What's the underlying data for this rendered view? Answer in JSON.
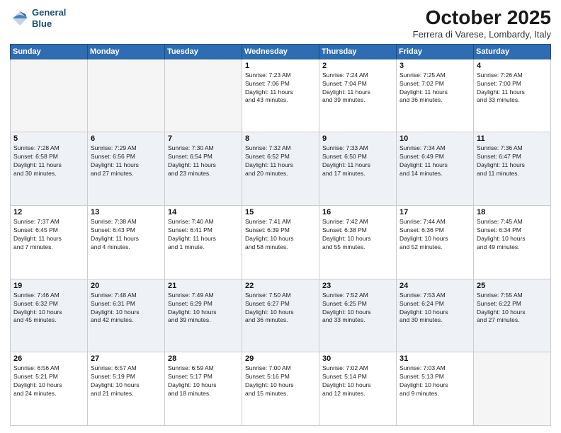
{
  "header": {
    "logo_line1": "General",
    "logo_line2": "Blue",
    "month": "October 2025",
    "location": "Ferrera di Varese, Lombardy, Italy"
  },
  "days_of_week": [
    "Sunday",
    "Monday",
    "Tuesday",
    "Wednesday",
    "Thursday",
    "Friday",
    "Saturday"
  ],
  "weeks": [
    [
      {
        "day": "",
        "info": ""
      },
      {
        "day": "",
        "info": ""
      },
      {
        "day": "",
        "info": ""
      },
      {
        "day": "1",
        "info": "Sunrise: 7:23 AM\nSunset: 7:06 PM\nDaylight: 11 hours\nand 43 minutes."
      },
      {
        "day": "2",
        "info": "Sunrise: 7:24 AM\nSunset: 7:04 PM\nDaylight: 11 hours\nand 39 minutes."
      },
      {
        "day": "3",
        "info": "Sunrise: 7:25 AM\nSunset: 7:02 PM\nDaylight: 11 hours\nand 36 minutes."
      },
      {
        "day": "4",
        "info": "Sunrise: 7:26 AM\nSunset: 7:00 PM\nDaylight: 11 hours\nand 33 minutes."
      }
    ],
    [
      {
        "day": "5",
        "info": "Sunrise: 7:28 AM\nSunset: 6:58 PM\nDaylight: 11 hours\nand 30 minutes."
      },
      {
        "day": "6",
        "info": "Sunrise: 7:29 AM\nSunset: 6:56 PM\nDaylight: 11 hours\nand 27 minutes."
      },
      {
        "day": "7",
        "info": "Sunrise: 7:30 AM\nSunset: 6:54 PM\nDaylight: 11 hours\nand 23 minutes."
      },
      {
        "day": "8",
        "info": "Sunrise: 7:32 AM\nSunset: 6:52 PM\nDaylight: 11 hours\nand 20 minutes."
      },
      {
        "day": "9",
        "info": "Sunrise: 7:33 AM\nSunset: 6:50 PM\nDaylight: 11 hours\nand 17 minutes."
      },
      {
        "day": "10",
        "info": "Sunrise: 7:34 AM\nSunset: 6:49 PM\nDaylight: 11 hours\nand 14 minutes."
      },
      {
        "day": "11",
        "info": "Sunrise: 7:36 AM\nSunset: 6:47 PM\nDaylight: 11 hours\nand 11 minutes."
      }
    ],
    [
      {
        "day": "12",
        "info": "Sunrise: 7:37 AM\nSunset: 6:45 PM\nDaylight: 11 hours\nand 7 minutes."
      },
      {
        "day": "13",
        "info": "Sunrise: 7:38 AM\nSunset: 6:43 PM\nDaylight: 11 hours\nand 4 minutes."
      },
      {
        "day": "14",
        "info": "Sunrise: 7:40 AM\nSunset: 6:41 PM\nDaylight: 11 hours\nand 1 minute."
      },
      {
        "day": "15",
        "info": "Sunrise: 7:41 AM\nSunset: 6:39 PM\nDaylight: 10 hours\nand 58 minutes."
      },
      {
        "day": "16",
        "info": "Sunrise: 7:42 AM\nSunset: 6:38 PM\nDaylight: 10 hours\nand 55 minutes."
      },
      {
        "day": "17",
        "info": "Sunrise: 7:44 AM\nSunset: 6:36 PM\nDaylight: 10 hours\nand 52 minutes."
      },
      {
        "day": "18",
        "info": "Sunrise: 7:45 AM\nSunset: 6:34 PM\nDaylight: 10 hours\nand 49 minutes."
      }
    ],
    [
      {
        "day": "19",
        "info": "Sunrise: 7:46 AM\nSunset: 6:32 PM\nDaylight: 10 hours\nand 45 minutes."
      },
      {
        "day": "20",
        "info": "Sunrise: 7:48 AM\nSunset: 6:31 PM\nDaylight: 10 hours\nand 42 minutes."
      },
      {
        "day": "21",
        "info": "Sunrise: 7:49 AM\nSunset: 6:29 PM\nDaylight: 10 hours\nand 39 minutes."
      },
      {
        "day": "22",
        "info": "Sunrise: 7:50 AM\nSunset: 6:27 PM\nDaylight: 10 hours\nand 36 minutes."
      },
      {
        "day": "23",
        "info": "Sunrise: 7:52 AM\nSunset: 6:25 PM\nDaylight: 10 hours\nand 33 minutes."
      },
      {
        "day": "24",
        "info": "Sunrise: 7:53 AM\nSunset: 6:24 PM\nDaylight: 10 hours\nand 30 minutes."
      },
      {
        "day": "25",
        "info": "Sunrise: 7:55 AM\nSunset: 6:22 PM\nDaylight: 10 hours\nand 27 minutes."
      }
    ],
    [
      {
        "day": "26",
        "info": "Sunrise: 6:56 AM\nSunset: 5:21 PM\nDaylight: 10 hours\nand 24 minutes."
      },
      {
        "day": "27",
        "info": "Sunrise: 6:57 AM\nSunset: 5:19 PM\nDaylight: 10 hours\nand 21 minutes."
      },
      {
        "day": "28",
        "info": "Sunrise: 6:59 AM\nSunset: 5:17 PM\nDaylight: 10 hours\nand 18 minutes."
      },
      {
        "day": "29",
        "info": "Sunrise: 7:00 AM\nSunset: 5:16 PM\nDaylight: 10 hours\nand 15 minutes."
      },
      {
        "day": "30",
        "info": "Sunrise: 7:02 AM\nSunset: 5:14 PM\nDaylight: 10 hours\nand 12 minutes."
      },
      {
        "day": "31",
        "info": "Sunrise: 7:03 AM\nSunset: 5:13 PM\nDaylight: 10 hours\nand 9 minutes."
      },
      {
        "day": "",
        "info": ""
      }
    ]
  ]
}
